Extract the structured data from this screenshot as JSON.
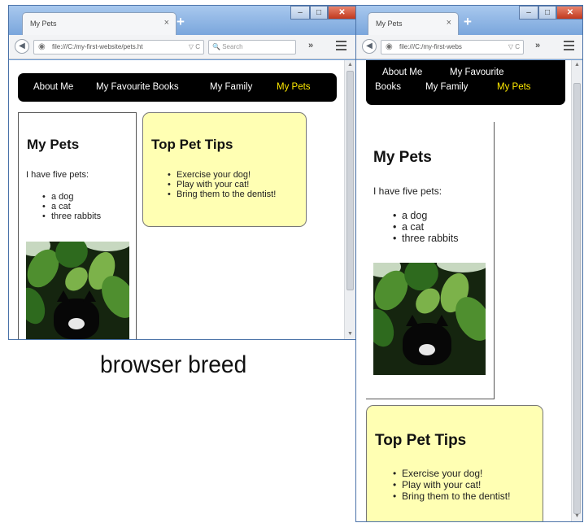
{
  "caption": "browser breed",
  "left_window": {
    "tab_title": "My Pets",
    "tab_close": "×",
    "new_tab": "+",
    "url": "file:///C:/my-first-website/pets.ht",
    "url_controls": "▽ C",
    "search_placeholder": "Search",
    "search_icon": "🔍",
    "overflow_label": "»"
  },
  "right_window": {
    "tab_title": "My Pets",
    "tab_close": "×",
    "new_tab": "+",
    "url": "file:///C:/my-first-webs",
    "url_controls": "▽ C",
    "overflow_label": "»"
  },
  "window_controls": {
    "minimize": "–",
    "maximize": "□",
    "close": "✕"
  },
  "page": {
    "nav": {
      "about": "About Me",
      "books": "My Favourite Books",
      "books_line1": "My Favourite",
      "books_line2": "Books",
      "family": "My Family",
      "pets": "My Pets"
    },
    "pets_heading": "My Pets",
    "pets_intro": "I have five pets:",
    "pets_list": [
      "a dog",
      "a cat",
      "three rabbits"
    ],
    "tips_heading": "Top Pet Tips",
    "tips_list": [
      "Exercise your dog!",
      "Play with your cat!",
      "Bring them to the dentist!"
    ]
  },
  "colors": {
    "nav_background": "#000000",
    "nav_active": "#ffea00",
    "tips_background": "#ffffb3",
    "window_frame": "#6f9fd8"
  }
}
